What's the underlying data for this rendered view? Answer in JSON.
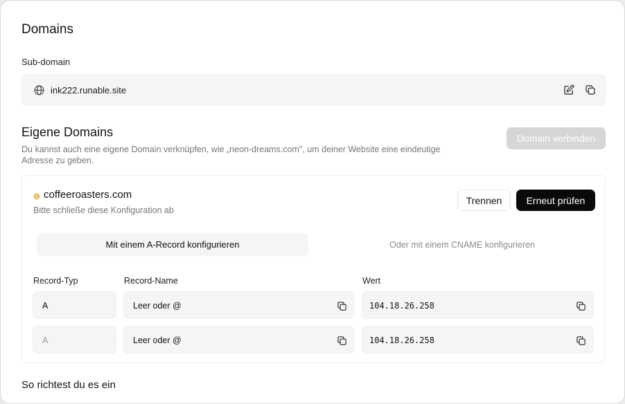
{
  "page": {
    "title": "Domains"
  },
  "subdomain": {
    "label": "Sub-domain",
    "value": "ink222.runable.site",
    "icons": {
      "site": "globe-icon",
      "edit": "pencil-square-icon",
      "copy": "copy-icon"
    }
  },
  "custom_domains": {
    "title": "Eigene Domains",
    "description": "Du kannst auch eine eigene Domain verknüpfen, wie „neon-dreams.com\", um deiner Website eine eindeutige Adresse zu geben.",
    "connect_button": "Domain verbinden",
    "connect_disabled": true
  },
  "domain_card": {
    "domain": "coffeeroasters.com",
    "status_color": "#e0a535",
    "hint": "Bitte schließe diese Konfiguration ab",
    "disconnect_button": "Trennen",
    "recheck_button": "Erneut prüfen",
    "tabs": [
      {
        "label": "Mit einem A-Record konfigurieren",
        "active": true
      },
      {
        "label": "Oder mit einem CNAME konfigurieren",
        "active": false
      }
    ],
    "columns": {
      "type": "Record-Typ",
      "name": "Record-Name",
      "value": "Wert"
    },
    "records": [
      {
        "type": "A",
        "name": "Leer oder @",
        "value": "104.18.26.258",
        "type_muted": false
      },
      {
        "type": "A",
        "name": "Leer oder @",
        "value": "104.18.26.258",
        "type_muted": true
      }
    ]
  },
  "guide": {
    "title": "So richtest du es ein"
  },
  "colors": {
    "primary": "#0a0a0a",
    "disabled_button": "#d6d6d6",
    "surface": "#f5f5f5"
  }
}
